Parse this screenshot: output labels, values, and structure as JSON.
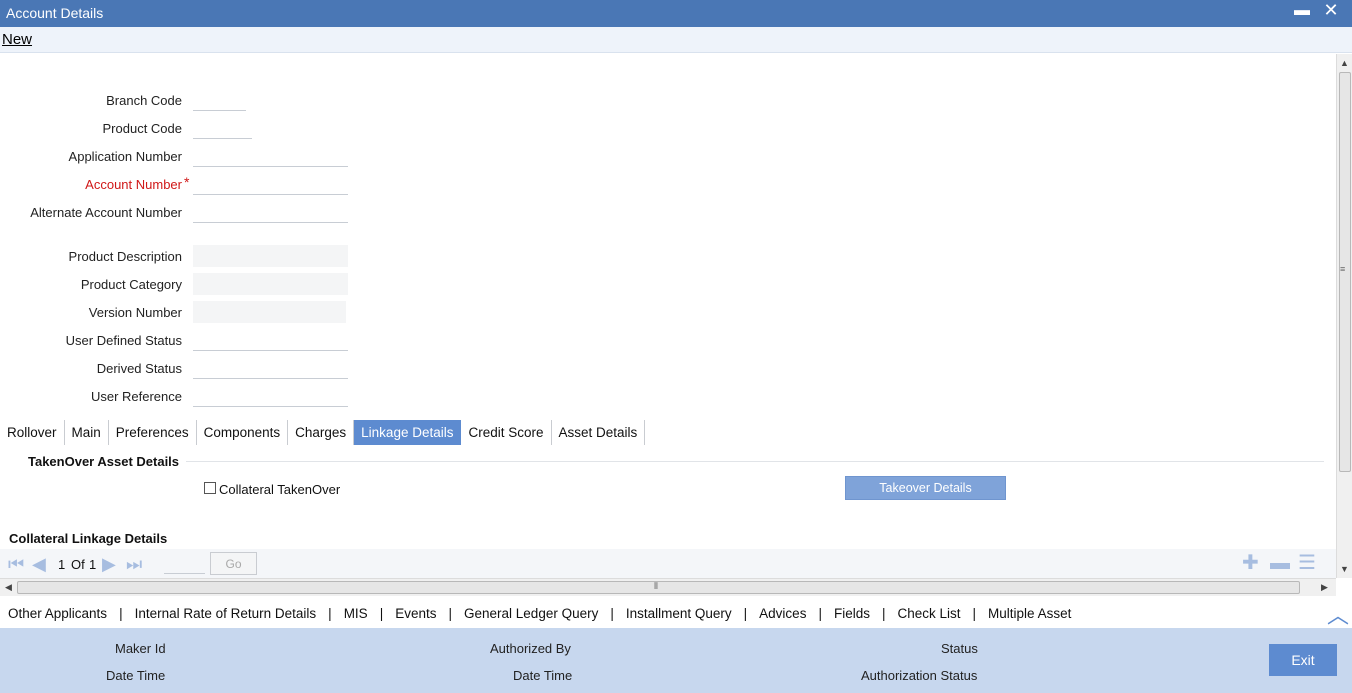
{
  "window": {
    "title": "Account Details",
    "minimize_glyph": "▬",
    "close_glyph": "✕"
  },
  "toolbar": {
    "new_label": "New"
  },
  "form": {
    "branch_code": {
      "label": "Branch Code",
      "value": ""
    },
    "product_code": {
      "label": "Product Code",
      "value": ""
    },
    "application_number": {
      "label": "Application Number",
      "value": ""
    },
    "account_number": {
      "label": "Account Number",
      "value": "",
      "required_mark": "*"
    },
    "alternate_account_number": {
      "label": "Alternate Account Number",
      "value": ""
    },
    "product_description": {
      "label": "Product Description",
      "value": ""
    },
    "product_category": {
      "label": "Product Category",
      "value": ""
    },
    "version_number": {
      "label": "Version Number",
      "value": ""
    },
    "user_defined_status": {
      "label": "User Defined Status",
      "value": ""
    },
    "derived_status": {
      "label": "Derived Status",
      "value": ""
    },
    "user_reference": {
      "label": "User Reference",
      "value": ""
    }
  },
  "tabs": [
    {
      "label": "Rollover"
    },
    {
      "label": "Main"
    },
    {
      "label": "Preferences"
    },
    {
      "label": "Components"
    },
    {
      "label": "Charges"
    },
    {
      "label": "Linkage Details",
      "active": true
    },
    {
      "label": "Credit Score"
    },
    {
      "label": "Asset Details"
    }
  ],
  "linkage": {
    "takeover_section_title": "TakenOver Asset Details",
    "collateral_takenover_label": "Collateral TakenOver",
    "collateral_takenover_checked": false,
    "takeover_button_label": "Takeover Details",
    "collateral_section_title": "Collateral Linkage Details"
  },
  "pager": {
    "current": "1",
    "of_label": "Of",
    "total": "1",
    "go_label": "Go",
    "page_input_value": ""
  },
  "bottom_links": [
    "Other Applicants",
    "Internal Rate of Return Details",
    "MIS",
    "Events",
    "General Ledger Query",
    "Installment Query",
    "Advices",
    "Fields",
    "Check List",
    "Multiple Asset"
  ],
  "footer": {
    "maker_id": "Maker Id",
    "date_time_1": "Date Time",
    "authorized_by": "Authorized By",
    "date_time_2": "Date Time",
    "status": "Status",
    "authorization_status": "Authorization Status",
    "exit_label": "Exit"
  },
  "colors": {
    "titlebar": "#4a77b5",
    "active_tab": "#5d8bd0",
    "footer": "#c7d7ee",
    "required": "#d01818"
  }
}
